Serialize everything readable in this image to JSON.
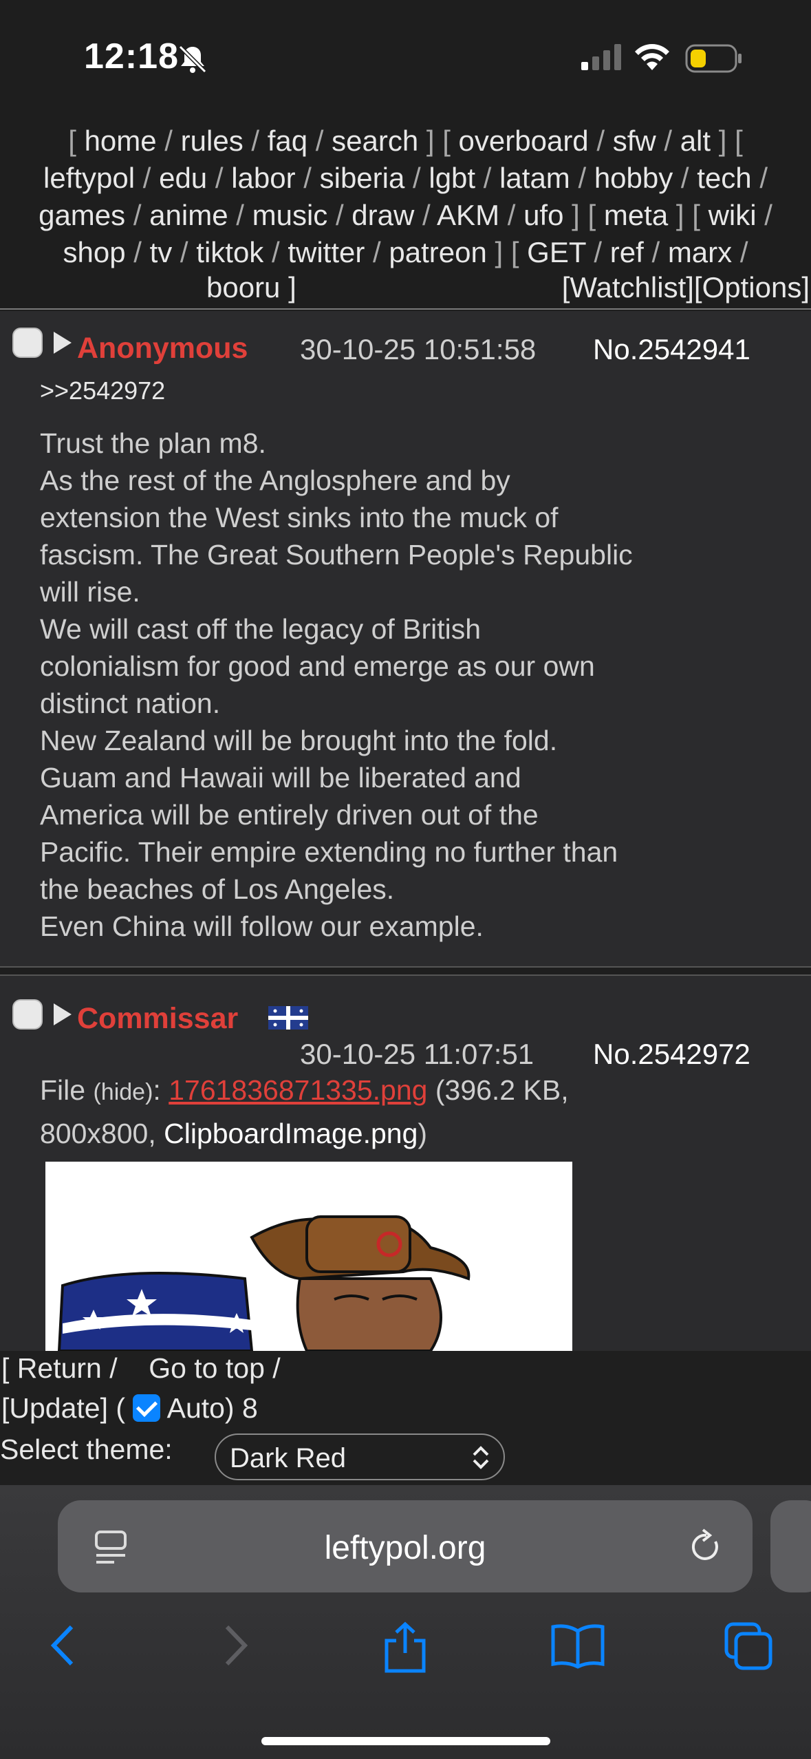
{
  "status_bar": {
    "time": "12:18"
  },
  "nav": {
    "rows": [
      [
        "[ ",
        "home",
        " / ",
        "rules",
        " / ",
        "faq",
        " / ",
        "search",
        " ] [ ",
        "overboard",
        " / ",
        "sfw",
        " / ",
        "alt",
        " ] ["
      ],
      [
        "leftypol",
        " / ",
        "edu",
        " / ",
        "labor",
        " / ",
        "siberia",
        " / ",
        "lgbt",
        " / ",
        "latam",
        " / ",
        "hobby",
        " / ",
        "tech",
        " /"
      ],
      [
        "games",
        " / ",
        "anime",
        " / ",
        "music",
        " / ",
        "draw",
        " / ",
        "AKM",
        " / ",
        "ufo",
        " ] [ ",
        "meta",
        " ] [ ",
        "wiki",
        " /"
      ],
      [
        "shop",
        " / ",
        "tv",
        " / ",
        "tiktok",
        " / ",
        "twitter",
        " / ",
        "patreon",
        " ] [ ",
        "GET",
        " / ",
        "ref",
        " / ",
        "marx",
        " /"
      ]
    ],
    "row5_left": "booru ]",
    "row5_right": "[Watchlist][Options]"
  },
  "post1": {
    "name": "Anonymous",
    "date": "30-10-25 10:51:58",
    "number": "No.2542941",
    "backlink": ">>2542972",
    "lines": [
      "Trust the plan m8.",
      "As the rest of the Anglosphere and by",
      "extension the West sinks into the muck of",
      "fascism. The Great Southern People's Republic",
      "will rise.",
      "We will cast off the legacy of British",
      "colonialism for good and emerge as our own",
      "distinct nation.",
      "New Zealand will be brought into the fold.",
      "Guam and Hawaii will be liberated and",
      "America will be entirely driven out of the",
      "Pacific. Their empire extending no further than",
      "the beaches of Los Angeles.",
      "Even China will follow our example."
    ]
  },
  "post2": {
    "name": "Commissar",
    "date": "30-10-25 11:07:51",
    "number": "No.2542972",
    "file_label": "File",
    "hide_label": "(hide)",
    "file_name": "1761836871335.png",
    "file_meta_1": "(396.2 KB,",
    "file_meta_2": "800x800,",
    "original_name": "ClipboardImage.png",
    "close_paren": ")"
  },
  "footer": {
    "return_label": "[ Return /",
    "top_label": "Go to top /",
    "update_label": "[Update] (",
    "auto_label": "Auto) 8",
    "theme_label": "Select theme:",
    "theme_value": "Dark Red"
  },
  "browser": {
    "url": "leftypol.org"
  },
  "colors": {
    "accent_name": "#e0403a",
    "ios_blue": "#0a84ff"
  }
}
